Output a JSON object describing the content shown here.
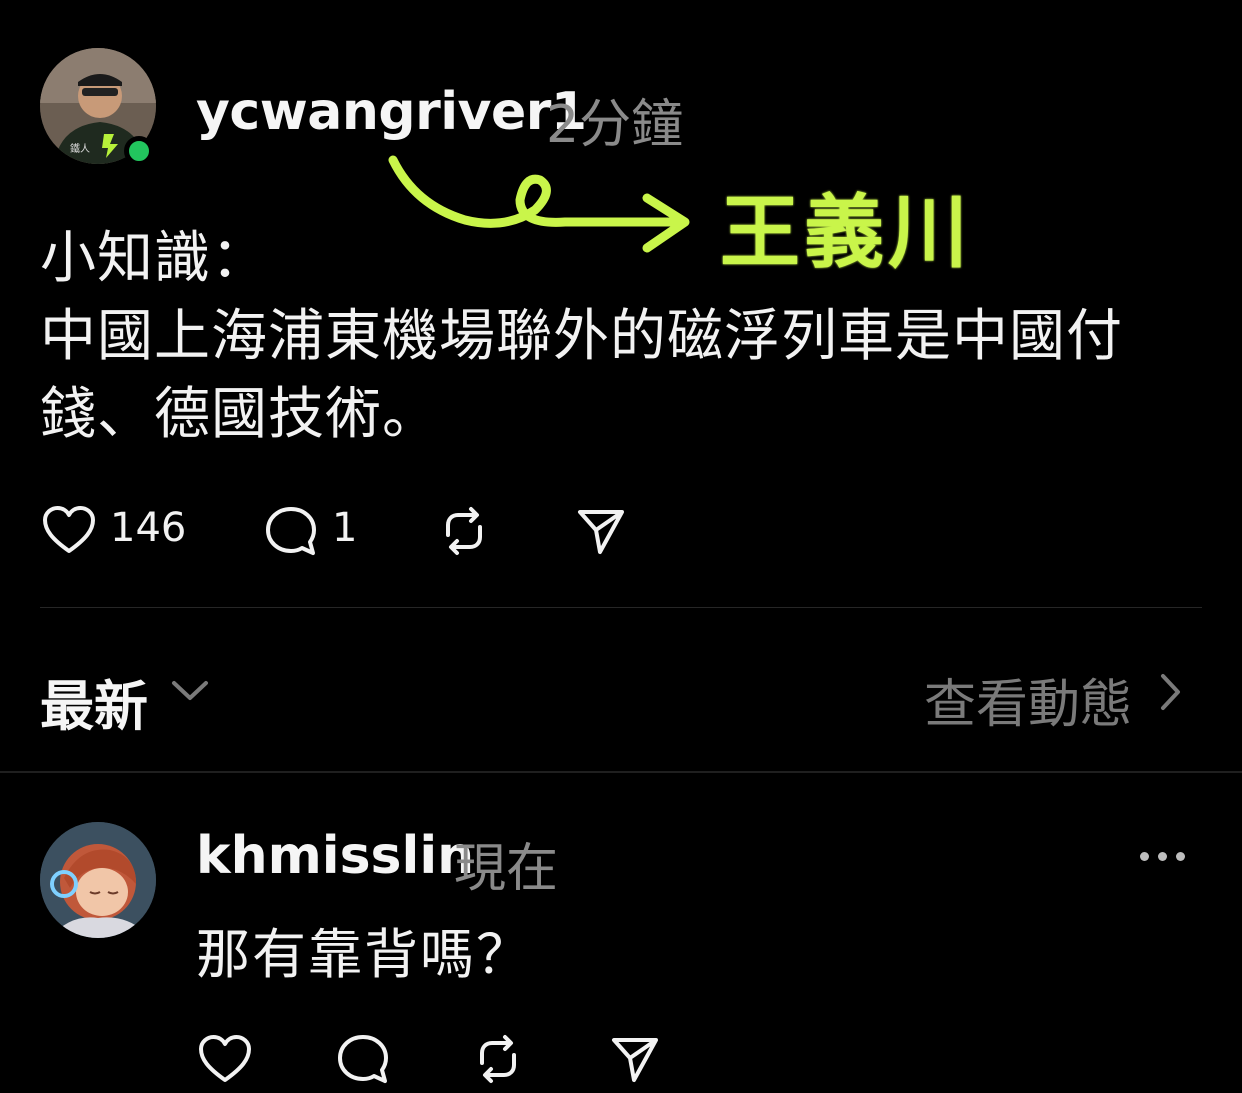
{
  "post": {
    "username": "ycwangriver1",
    "timestamp": "2分鐘",
    "annotation": "王義川",
    "text_lines": [
      "小知識：",
      "中國上海浦東機場聯外的磁浮列車是中國付",
      "錢、德國技術。"
    ],
    "likes": "146",
    "comments": "1",
    "avatar_badge": "鐵人"
  },
  "sort": {
    "label": "最新",
    "activity_link": "查看動態"
  },
  "reply": {
    "username": "khmisslin",
    "timestamp": "現在",
    "text": "那有靠背嗎？"
  },
  "colors": {
    "background": "#000000",
    "accent_annotation": "#c9f54a",
    "online": "#22c55e",
    "muted": "#8a8a8a"
  },
  "icons": [
    "heart-icon",
    "comment-icon",
    "repost-icon",
    "share-icon",
    "chevron-down-icon",
    "chevron-right-icon",
    "more-icon"
  ]
}
